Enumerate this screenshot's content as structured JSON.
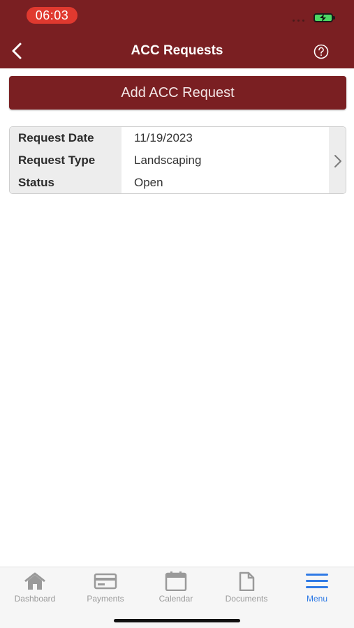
{
  "status_bar": {
    "time": "06:03"
  },
  "header": {
    "title": "ACC Requests"
  },
  "actions": {
    "add_label": "Add ACC Request"
  },
  "requests": [
    {
      "date_label": "Request Date",
      "date": "11/19/2023",
      "type_label": "Request Type",
      "type": "Landscaping",
      "status_label": "Status",
      "status": "Open"
    }
  ],
  "tabs": [
    {
      "label": "Dashboard",
      "icon": "home-icon",
      "active": false
    },
    {
      "label": "Payments",
      "icon": "credit-card-icon",
      "active": false
    },
    {
      "label": "Calendar",
      "icon": "calendar-icon",
      "active": false
    },
    {
      "label": "Documents",
      "icon": "document-icon",
      "active": false
    },
    {
      "label": "Menu",
      "icon": "menu-icon",
      "active": true
    }
  ],
  "colors": {
    "brand": "#7a1f22",
    "active_tab": "#2f7ae5",
    "inactive_tab": "#9a9a9a"
  }
}
